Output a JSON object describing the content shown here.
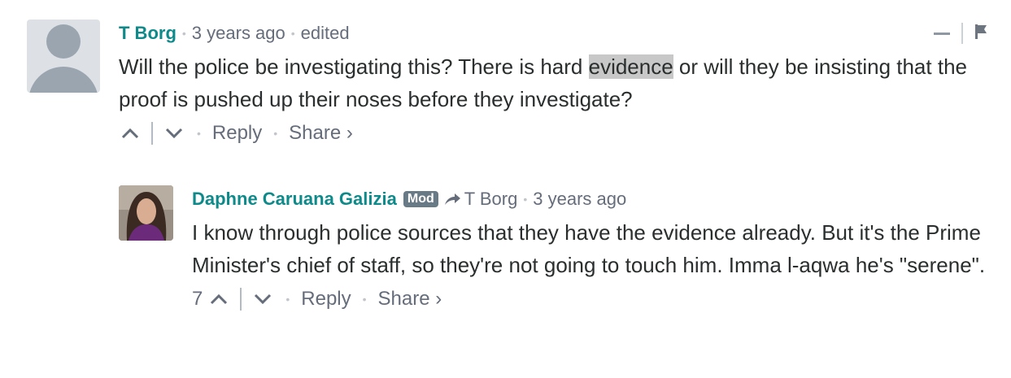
{
  "comments": [
    {
      "author": "T Borg",
      "time": "3 years ago",
      "edited": "edited",
      "text_before": "Will the police be investigating this? There is hard ",
      "text_highlight": "evidence",
      "text_after": " or will they be insisting that the proof is pushed up their noses before they investigate?",
      "reply_label": "Reply",
      "share_label": "Share ›",
      "icons": [
        "upvote-icon",
        "downvote-icon",
        "collapse-icon",
        "flag-icon"
      ]
    },
    {
      "author": "Daphne Caruana Galizia",
      "badge": "Mod",
      "in_reply_to": "T Borg",
      "time": "3 years ago",
      "text": "I know through police sources that they have the evidence already. But it's the Prime Minister's chief of staff, so they're not going to touch him. Imma l-aqwa he's \"serene\".",
      "votes": "7",
      "reply_label": "Reply",
      "share_label": "Share ›",
      "icons": [
        "reply-arrow-icon",
        "upvote-icon",
        "downvote-icon"
      ]
    }
  ],
  "colors": {
    "author": "#0e8a8a",
    "meta": "#656c7a",
    "text": "#2a2e2e",
    "highlight": "#c8c8c8",
    "badge": "#687a86"
  }
}
